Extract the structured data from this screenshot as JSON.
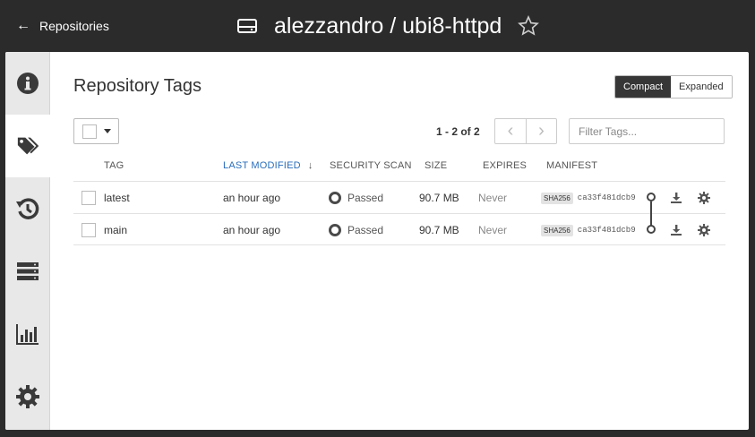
{
  "header": {
    "back_label": "Repositories",
    "repo_name": "alezzandro / ubi8-httpd",
    "icons": {
      "back": "arrow-left-icon",
      "repo": "hdd-icon",
      "star": "star-outline-icon"
    }
  },
  "sidenav": {
    "items": [
      {
        "icon": "info-circle-icon",
        "active": false
      },
      {
        "icon": "tags-icon",
        "active": true
      },
      {
        "icon": "history-icon",
        "active": false
      },
      {
        "icon": "server-icon",
        "active": false
      },
      {
        "icon": "bar-chart-icon",
        "active": false
      },
      {
        "icon": "gear-icon",
        "active": false
      }
    ]
  },
  "main": {
    "title": "Repository Tags",
    "view_modes": [
      "Compact",
      "Expanded"
    ],
    "selected_view": "Compact",
    "pagination": "1 - 2 of 2",
    "filter_placeholder": "Filter Tags...",
    "columns": [
      "TAG",
      "LAST MODIFIED",
      "SECURITY SCAN",
      "SIZE",
      "EXPIRES",
      "MANIFEST"
    ],
    "sorted_column": "LAST MODIFIED",
    "sort_arrow": "↓",
    "rows": [
      {
        "tag": "latest",
        "modified": "an hour ago",
        "scan": "Passed",
        "size": "90.7 MB",
        "expires": "Never",
        "algo": "SHA256",
        "digest": "ca33f481dcb9"
      },
      {
        "tag": "main",
        "modified": "an hour ago",
        "scan": "Passed",
        "size": "90.7 MB",
        "expires": "Never",
        "algo": "SHA256",
        "digest": "ca33f481dcb9"
      }
    ]
  },
  "colors": {
    "topbar": "#2b2b2b",
    "accent": "#2a6ebb",
    "active_toggle": "#363636",
    "sidenav": "#e8e8e8"
  }
}
